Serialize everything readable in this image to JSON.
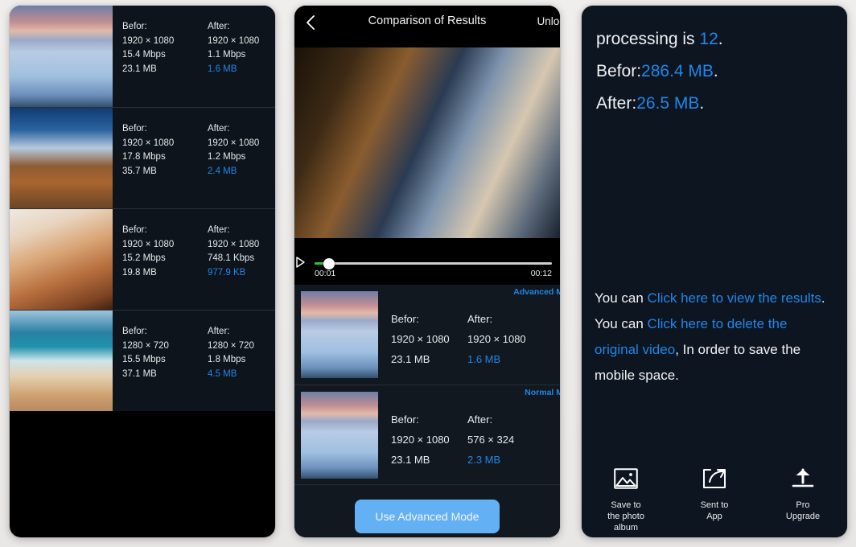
{
  "results_panel": {
    "name": "compression-results-list",
    "label_before": "Befor:",
    "label_after": "After:",
    "rows": [
      {
        "before_res": "1920 × 1080",
        "before_rate": "15.4 Mbps",
        "before_size": "23.1 MB",
        "after_res": "1920 × 1080",
        "after_rate": "1.1 Mbps",
        "after_size": "1.6 MB",
        "thumb": "sunset-over-water"
      },
      {
        "before_res": "1920 × 1080",
        "before_rate": "17.8 Mbps",
        "before_size": "35.7 MB",
        "after_res": "1920 × 1080",
        "after_rate": "1.2 Mbps",
        "after_size": "2.4 MB",
        "thumb": "autumn-lake-trees"
      },
      {
        "before_res": "1920 × 1080",
        "before_rate": "15.2 Mbps",
        "before_size": "19.8 MB",
        "after_res": "1920 × 1080",
        "after_rate": "748.1 Kbps",
        "after_size": "977.9 KB",
        "thumb": "portrait-woman"
      },
      {
        "before_res": "1280 × 720",
        "before_rate": "15.5 Mbps",
        "before_size": "37.1 MB",
        "after_res": "1280 × 720",
        "after_rate": "1.8 Mbps",
        "after_size": "4.5 MB",
        "thumb": "beach-archway"
      }
    ]
  },
  "compare_panel": {
    "title": "Comparison of Results",
    "unlock_label": "Unloc",
    "back_icon": "chevron-left-icon",
    "player": {
      "play_icon": "play-icon",
      "current_time": "00:01",
      "total_time": "00:12",
      "progress_percent": 6
    },
    "label_before": "Befor:",
    "label_after": "After:",
    "rows": [
      {
        "tag": "Advanced M",
        "before_res": "1920 × 1080",
        "before_size": "23.1 MB",
        "after_res": "1920 × 1080",
        "after_size": "1.6 MB"
      },
      {
        "tag": "Normal M",
        "before_res": "1920 × 1080",
        "before_size": "23.1 MB",
        "after_res": "576 × 324",
        "after_size": "2.3 MB"
      }
    ],
    "advanced_button": "Use Advanced Mode"
  },
  "summary_panel": {
    "headline": {
      "line1_prefix": "processing is ",
      "line1_value": "12",
      "line1_suffix": ".",
      "line2_prefix": "Befor:",
      "line2_value": "286.4 MB",
      "line2_suffix": ".",
      "line3_prefix": "After:",
      "line3_value": "26.5 MB",
      "line3_suffix": "."
    },
    "paragraph1": {
      "prefix": "You can ",
      "link": "Click here to view the results",
      "suffix": "."
    },
    "paragraph2": {
      "prefix": "You can ",
      "link": "Click here to delete the original video",
      "suffix": ", In order to save the mobile space."
    },
    "actions": [
      {
        "icon": "photo-album-icon",
        "caption": "Save to\nthe photo\nalbum"
      },
      {
        "icon": "share-to-app-icon",
        "caption": "Sent to\nApp"
      },
      {
        "icon": "upload-arrow-icon",
        "caption": "Pro\nUpgrade"
      }
    ]
  },
  "colors": {
    "accent_blue": "#1f87e8",
    "button_blue": "#64b0f4",
    "progress_green": "#27c437",
    "panel_dark": "#111820",
    "summary_bg": "#0d1520"
  }
}
